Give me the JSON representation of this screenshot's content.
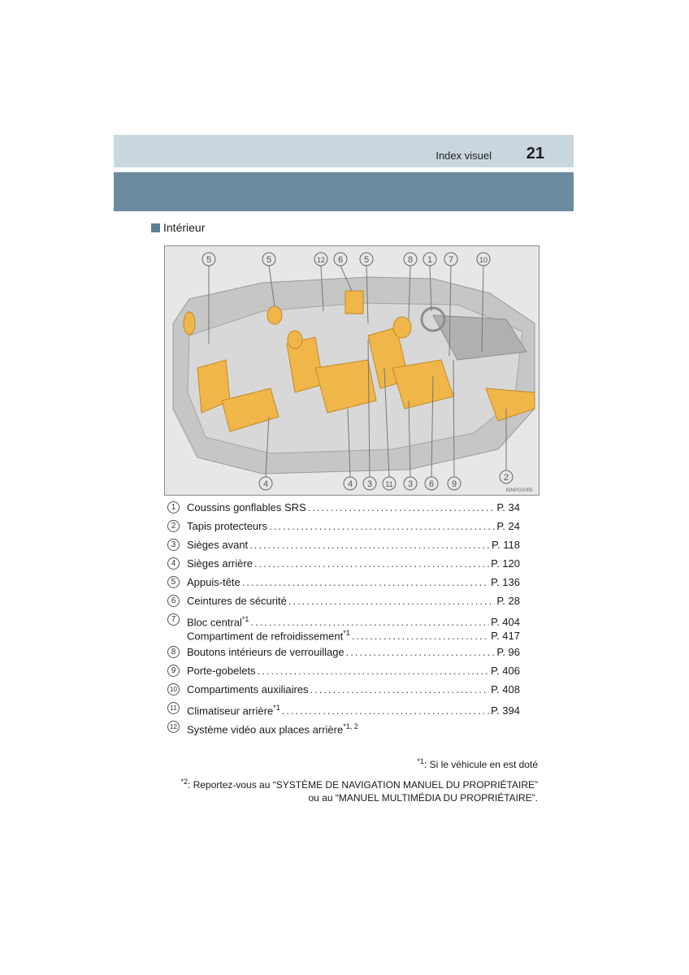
{
  "header": {
    "title": "Index visuel",
    "page_number": "21"
  },
  "section": {
    "heading": "Intérieur"
  },
  "illustration": {
    "image_code": "INNPGX005",
    "colors": {
      "highlight": "#f0b64a",
      "body": "#b8b8b8",
      "background": "#e7e7e7"
    },
    "callouts": [
      "5",
      "5",
      "12",
      "6",
      "5",
      "8",
      "1",
      "7",
      "10",
      "4",
      "4",
      "3",
      "11",
      "3",
      "6",
      "9",
      "2"
    ]
  },
  "index": [
    {
      "num": "1",
      "label": "Coussins gonflables SRS",
      "sup": "",
      "page": "P. 34"
    },
    {
      "num": "2",
      "label": "Tapis protecteurs",
      "sup": "",
      "page": "P. 24"
    },
    {
      "num": "3",
      "label": "Sièges avant",
      "sup": "",
      "page": "P. 118"
    },
    {
      "num": "4",
      "label": "Sièges arrière",
      "sup": "",
      "page": "P. 120"
    },
    {
      "num": "5",
      "label": "Appuis-tête",
      "sup": "",
      "page": "P. 136"
    },
    {
      "num": "6",
      "label": "Ceintures de sécurité",
      "sup": "",
      "page": "P. 28"
    },
    {
      "num": "7",
      "label": "Bloc central",
      "sup": "*1",
      "page": "P. 404",
      "sub": {
        "label": "Compartiment de refroidissement",
        "sup": "*1",
        "page": "P. 417"
      }
    },
    {
      "num": "8",
      "label": "Boutons intérieurs de verrouillage",
      "sup": "",
      "page": "P. 96"
    },
    {
      "num": "9",
      "label": "Porte-gobelets",
      "sup": "",
      "page": "P. 406"
    },
    {
      "num": "10",
      "label": "Compartiments auxiliaires",
      "sup": "",
      "page": "P. 408"
    },
    {
      "num": "11",
      "label": "Climatiseur arrière",
      "sup": "*1",
      "page": "P. 394"
    },
    {
      "num": "12",
      "label": "Système vidéo aux places arrière",
      "sup": "*1, 2",
      "page": ""
    }
  ],
  "footnotes": {
    "fn1": {
      "mark": "*1",
      "text": ": Si le véhicule en est doté"
    },
    "fn2": {
      "mark": "*2",
      "line1": ": Reportez-vous au “SYSTÈME DE NAVIGATION MANUEL DU PROPRIÉTAIRE”",
      "line2": "ou au “MANUEL MULTIMÉDIA DU PROPRIÉTAIRE”."
    }
  }
}
